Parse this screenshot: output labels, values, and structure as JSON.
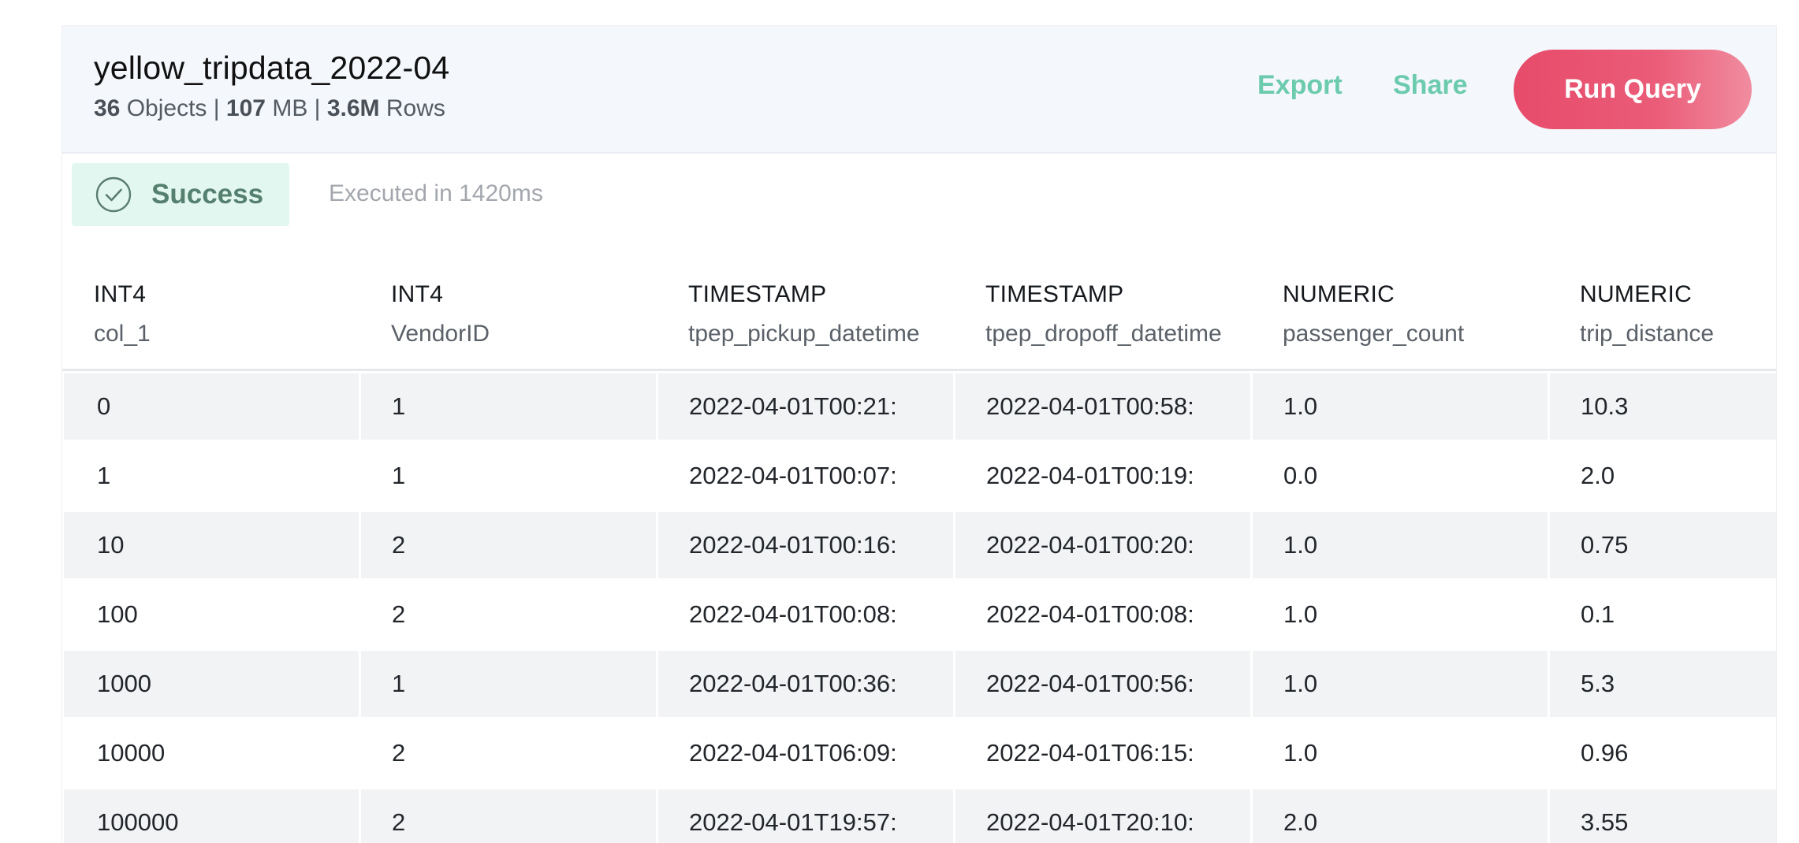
{
  "header": {
    "title": "yellow_tripdata_2022-04",
    "meta": {
      "objects_count": "36",
      "objects_label": "Objects",
      "separator": "|",
      "size_value": "107",
      "size_unit": "MB",
      "rows_value": "3.6M",
      "rows_label": "Rows"
    },
    "export_label": "Export",
    "share_label": "Share",
    "run_label": "Run Query"
  },
  "status": {
    "label": "Success",
    "execution": "Executed in 1420ms"
  },
  "colors": {
    "accent_green": "#6ccbad",
    "run_button": "#e74b6a",
    "success_bg": "#e2f7f0"
  },
  "table": {
    "columns": [
      {
        "type": "INT4",
        "name": "col_1"
      },
      {
        "type": "INT4",
        "name": "VendorID"
      },
      {
        "type": "TIMESTAMP",
        "name": "tpep_pickup_datetime"
      },
      {
        "type": "TIMESTAMP",
        "name": "tpep_dropoff_datetime"
      },
      {
        "type": "NUMERIC",
        "name": "passenger_count"
      },
      {
        "type": "NUMERIC",
        "name": "trip_distance"
      }
    ],
    "rows": [
      [
        "0",
        "1",
        "2022-04-01T00:21:",
        "2022-04-01T00:58:",
        "1.0",
        "10.3"
      ],
      [
        "1",
        "1",
        "2022-04-01T00:07:",
        "2022-04-01T00:19:",
        "0.0",
        "2.0"
      ],
      [
        "10",
        "2",
        "2022-04-01T00:16:",
        "2022-04-01T00:20:",
        "1.0",
        "0.75"
      ],
      [
        "100",
        "2",
        "2022-04-01T00:08:",
        "2022-04-01T00:08:",
        "1.0",
        "0.1"
      ],
      [
        "1000",
        "1",
        "2022-04-01T00:36:",
        "2022-04-01T00:56:",
        "1.0",
        "5.3"
      ],
      [
        "10000",
        "2",
        "2022-04-01T06:09:",
        "2022-04-01T06:15:",
        "1.0",
        "0.96"
      ],
      [
        "100000",
        "2",
        "2022-04-01T19:57:",
        "2022-04-01T20:10:",
        "2.0",
        "3.55"
      ]
    ]
  }
}
